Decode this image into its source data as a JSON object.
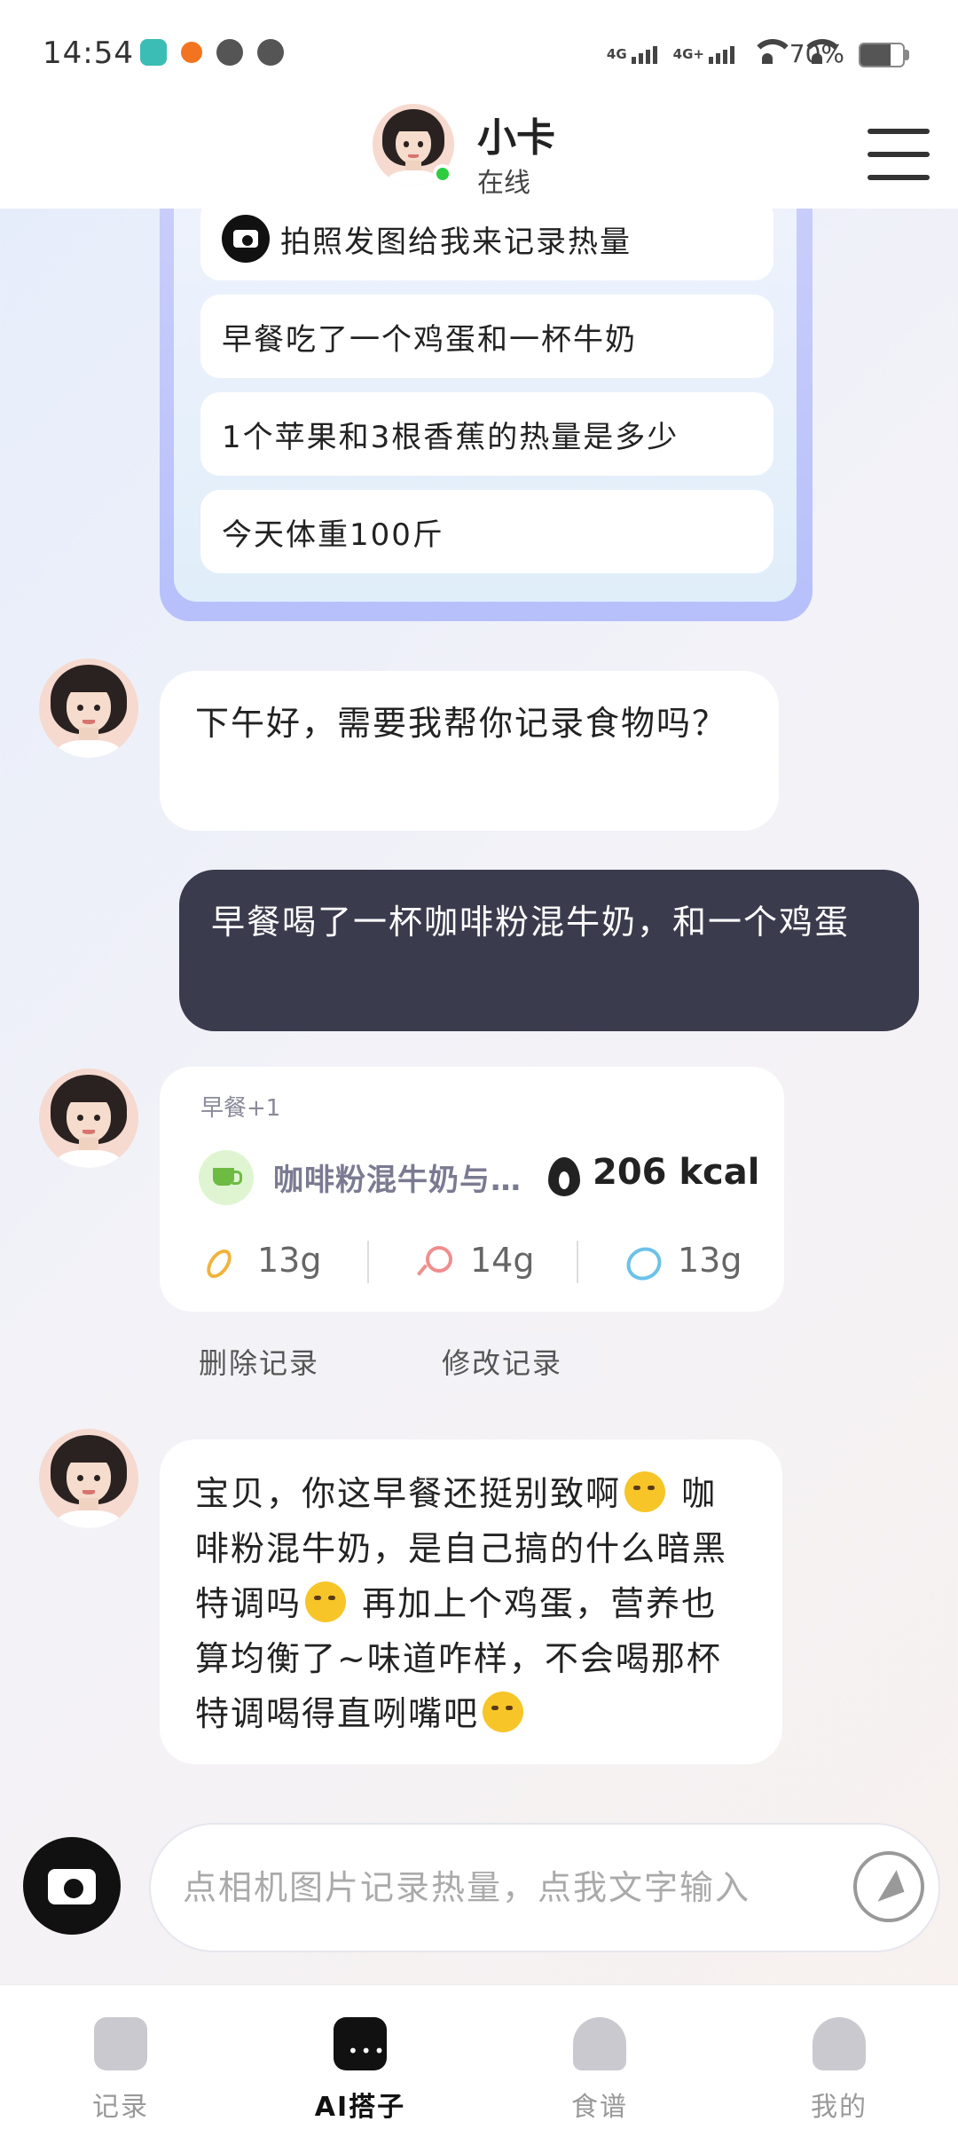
{
  "status_bar": {
    "time": "14:54",
    "signal1": "4G",
    "signal2": "4G+",
    "battery": "70%"
  },
  "header": {
    "name": "小卡",
    "status": "在线",
    "online_color": "#2ecc40"
  },
  "suggestions": [
    "拍照发图给我来记录热量",
    "早餐吃了一个鸡蛋和一杯牛奶",
    "1个苹果和3根香蕉的热量是多少",
    "今天体重100斤"
  ],
  "messages": {
    "bot1": "下午好，需要我帮你记录食物吗？",
    "user1": "早餐喝了一杯咖啡粉混牛奶，和一个鸡蛋",
    "meal_card": {
      "tag": "早餐+1",
      "name": "咖啡粉混牛奶与…",
      "kcal": "206 kcal",
      "carbs": "13g",
      "protein": "14g",
      "fat": "13g"
    },
    "actions": {
      "delete": "删除记录",
      "edit": "修改记录"
    },
    "bot2_parts": [
      "宝贝，你这早餐还挺别致啊",
      " 咖啡粉混牛奶，是自己搞的什么暗黑特调吗",
      " 再加上个鸡蛋，营养也算均衡了~味道咋样，不会喝那杯特调喝得直咧嘴吧"
    ]
  },
  "input": {
    "placeholder": "点相机图片记录热量，点我文字输入"
  },
  "nav": {
    "items": [
      {
        "label": "记录",
        "icon": "calendar-check-icon"
      },
      {
        "label": "AI搭子",
        "icon": "chat-bubble-icon",
        "active": true
      },
      {
        "label": "食谱",
        "icon": "chef-hat-icon"
      },
      {
        "label": "我的",
        "icon": "user-icon"
      }
    ]
  },
  "colors": {
    "user_bubble": "#3a3b4d",
    "accent_green": "#6dbb43",
    "card_gradient": "#b7c0fb"
  }
}
